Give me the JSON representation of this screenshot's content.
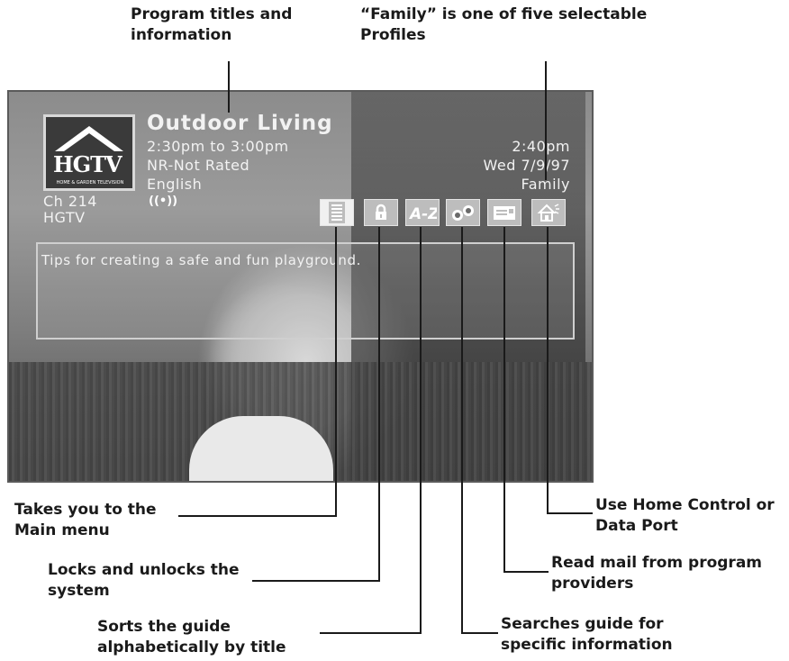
{
  "callouts": {
    "program_titles": "Program titles and information",
    "profiles": "“Family” is one of five selectable Profiles",
    "main_menu": "Takes you to the Main menu",
    "lock": "Locks and unlocks the system",
    "sort": "Sorts the guide alphabetically by title",
    "search": "Searches guide for specific information",
    "mail": "Read mail from program providers",
    "home_control": "Use Home Control or Data Port"
  },
  "screen": {
    "logo_text": "HGTV",
    "logo_subtext": "HOME & GARDEN TELEVISION",
    "program_title": "Outdoor Living",
    "time_range": "2:30pm to 3:00pm",
    "rating": "NR-Not Rated",
    "language": "English",
    "channel_number": "Ch 214",
    "channel_name": "HGTV",
    "current_time": "2:40pm",
    "current_date": "Wed 7/9/97",
    "profile": "Family",
    "description": "Tips for creating a safe and fun playground."
  },
  "icons": [
    "main-menu-icon",
    "lock-icon",
    "az-sort-icon",
    "binoculars-search-icon",
    "mail-icon",
    "home-control-icon"
  ],
  "colors": {
    "callout_text": "#1a1a1a",
    "screen_text": "#f2f2f2",
    "leader_line": "#1a1a1a"
  }
}
